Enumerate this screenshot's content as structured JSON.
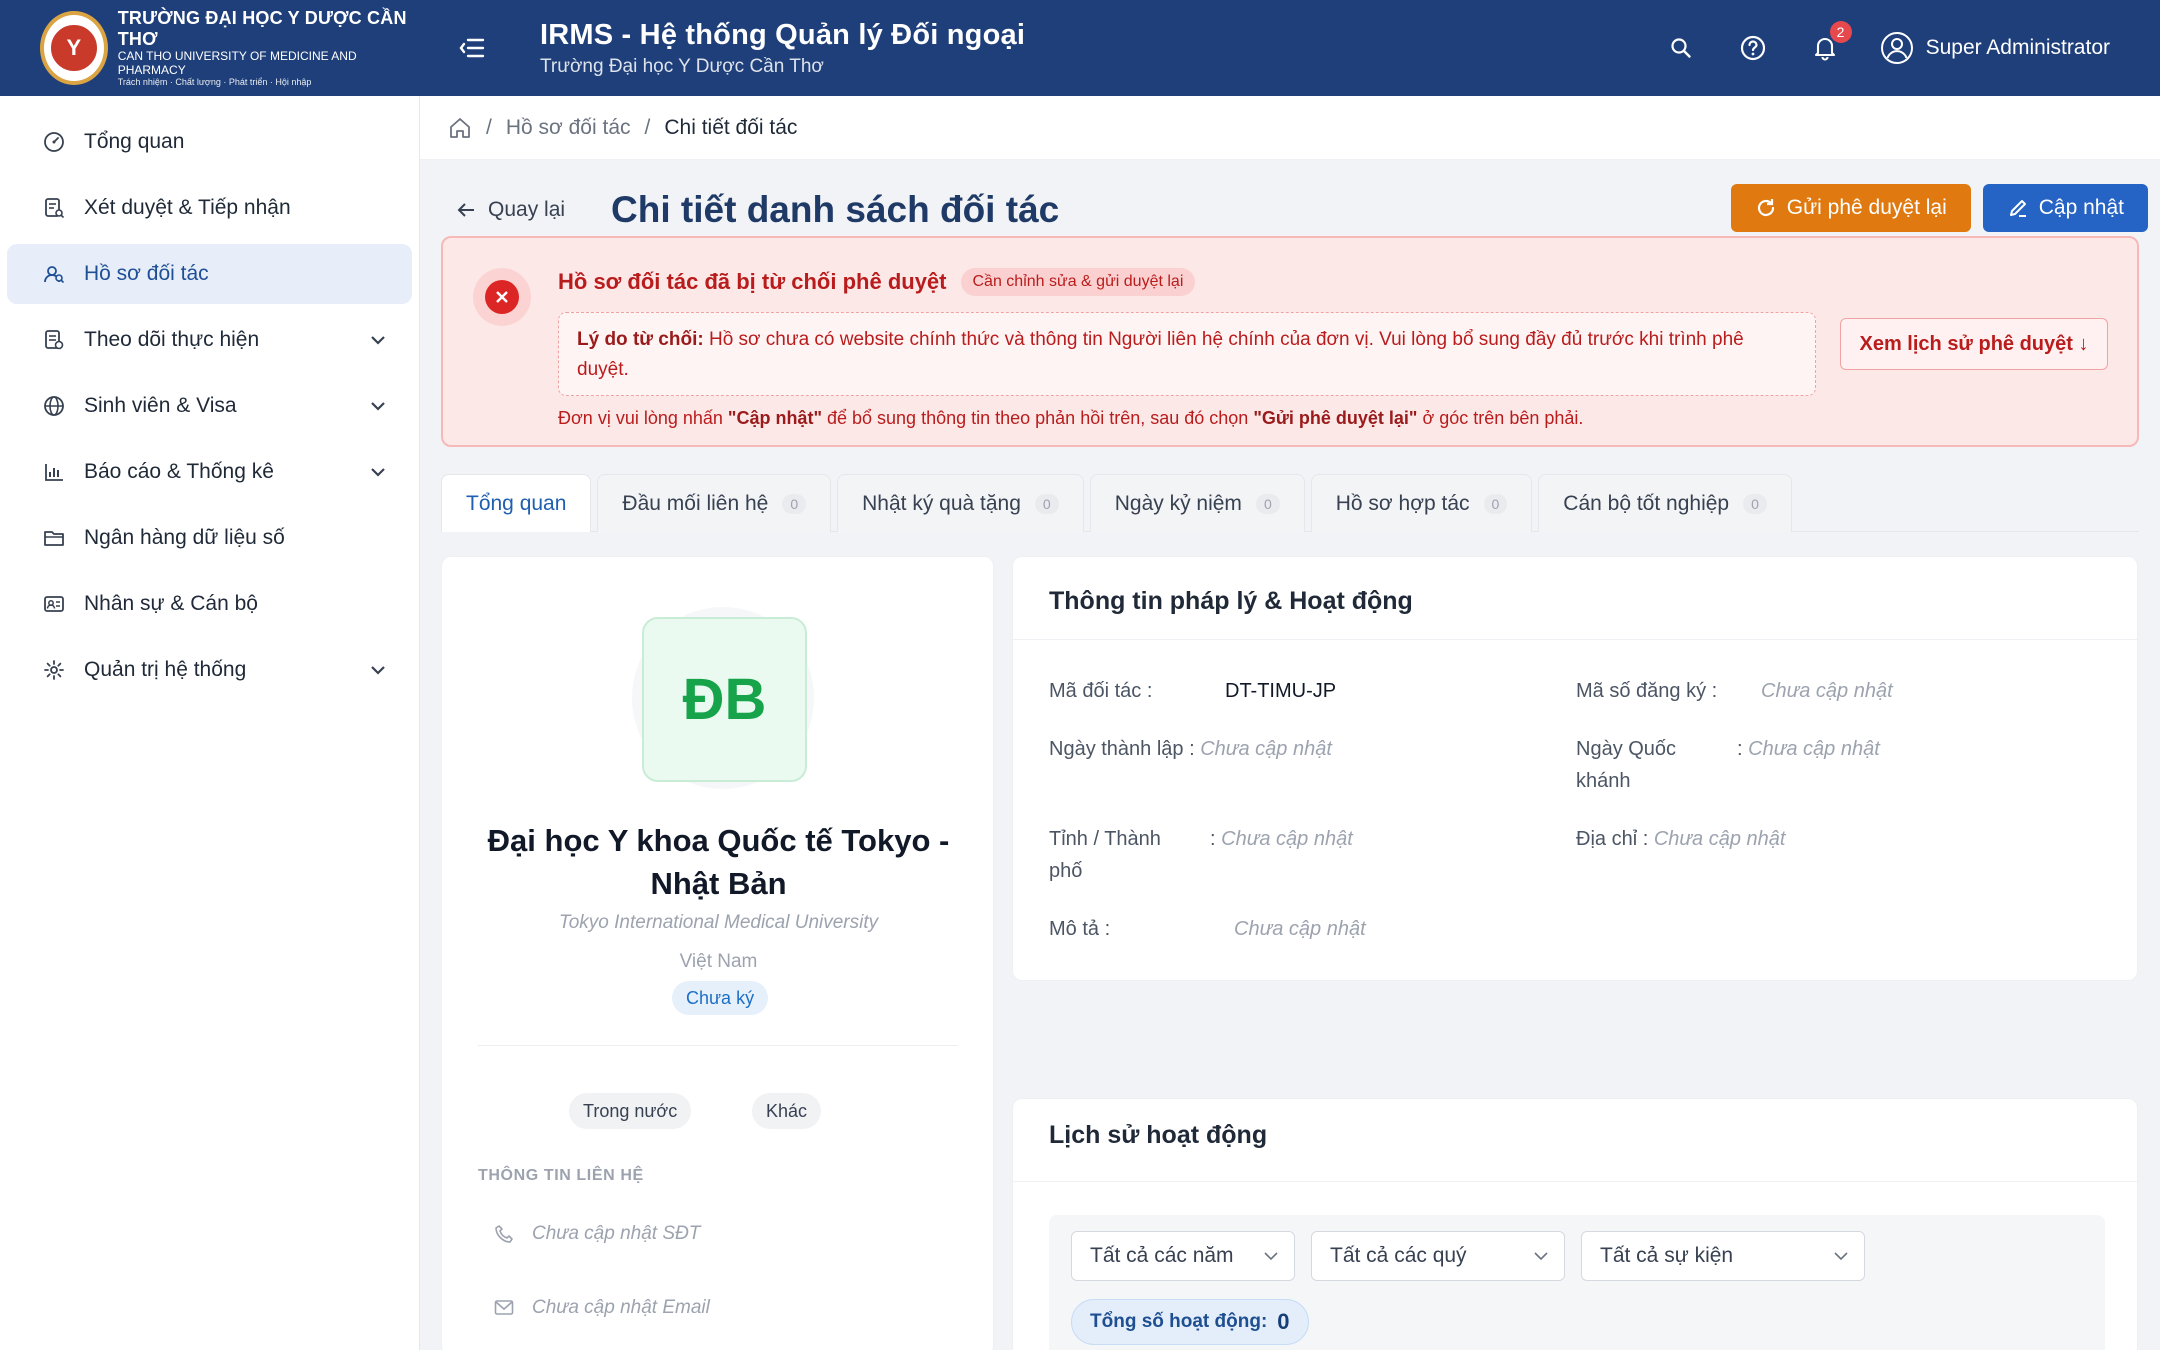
{
  "header": {
    "logo_initials": "Y",
    "logo_line1": "TRƯỜNG ĐẠI HỌC Y DƯỢC CẦN THƠ",
    "logo_line2": "CAN THO UNIVERSITY OF MEDICINE AND PHARMACY",
    "logo_line3": "Trách nhiệm · Chất lượng · Phát triển · Hội nhập",
    "app_title": "IRMS - Hệ thống Quản lý Đối ngoại",
    "app_subtitle": "Trường Đại học Y Dược Cần Thơ",
    "notification_count": "2",
    "user_name": "Super Administrator"
  },
  "sidebar": {
    "items": [
      {
        "label": "Tổng quan",
        "icon": "dashboard-icon"
      },
      {
        "label": "Xét duyệt & Tiếp nhận",
        "icon": "review-icon"
      },
      {
        "label": "Hồ sơ đối tác",
        "icon": "partners-icon",
        "active": true
      },
      {
        "label": "Theo dõi thực hiện",
        "icon": "tracking-icon",
        "expandable": true
      },
      {
        "label": "Sinh viên & Visa",
        "icon": "globe-icon",
        "expandable": true
      },
      {
        "label": "Báo cáo & Thống kê",
        "icon": "chart-icon",
        "expandable": true
      },
      {
        "label": "Ngân hàng dữ liệu số",
        "icon": "folder-icon"
      },
      {
        "label": "Nhân sự & Cán bộ",
        "icon": "id-card-icon"
      },
      {
        "label": "Quản trị hệ thống",
        "icon": "gear-icon",
        "expandable": true
      }
    ]
  },
  "breadcrumb": {
    "parent": "Hồ sơ đối tác",
    "current": "Chi tiết đối tác"
  },
  "page": {
    "back_label": "Quay lại",
    "title": "Chi tiết danh sách đối tác",
    "resubmit_label": "Gửi phê duyệt lại",
    "update_label": "Cập nhật"
  },
  "alert": {
    "title": "Hồ sơ đối tác đã bị từ chối phê duyệt",
    "tag": "Cần chỉnh sửa & gửi duyệt lại",
    "reason_label": "Lý do từ chối:",
    "reason_text": "Hồ sơ chưa có website chính thức và thông tin Người liên hệ chính của đơn vị. Vui lòng bổ sung đầy đủ trước khi trình phê duyệt.",
    "note_pre": "Đơn vị vui lòng nhấn ",
    "note_btn1": "\"Cập nhật\"",
    "note_mid": " để bổ sung thông tin theo phản hồi trên, sau đó chọn ",
    "note_btn2": "\"Gửi phê duyệt lại\"",
    "note_post": " ở góc trên bên phải.",
    "history_label": "Xem lịch sử phê duyệt ↓"
  },
  "tabs": [
    {
      "label": "Tổng quan",
      "active": true
    },
    {
      "label": "Đầu mối liên hệ",
      "count": "0"
    },
    {
      "label": "Nhật ký quà tặng",
      "count": "0"
    },
    {
      "label": "Ngày kỷ niệm",
      "count": "0"
    },
    {
      "label": "Hồ sơ hợp tác",
      "count": "0"
    },
    {
      "label": "Cán bộ tốt nghiệp",
      "count": "0"
    }
  ],
  "profile": {
    "initials": "ĐB",
    "name_line1": "Đại học Y khoa Quốc tế Tokyo -",
    "name_line2": "Nhật Bản",
    "name_en": "Tokyo International Medical University",
    "country": "Việt Nam",
    "sign_status": "Chưa ký",
    "chips": [
      "Trong nước",
      "Khác"
    ],
    "contact_section": "THÔNG TIN LIÊN HỆ",
    "phone": "Chưa cập nhật SĐT",
    "email": "Chưa cập nhật Email"
  },
  "legal": {
    "title": "Thông tin pháp lý & Hoạt động",
    "partner_code_label": "Mã đối tác",
    "partner_code": "DT-TIMU-JP",
    "reg_no_label": "Mã số đăng ký",
    "reg_no": "Chưa cập nhật",
    "founded_label": "Ngày thành lập",
    "founded": "Chưa cập nhật",
    "national_day_label_1": "Ngày Quốc",
    "national_day_label_2": "khánh",
    "national_day": "Chưa cập nhật",
    "province_label_1": "Tỉnh / Thành",
    "province_label_2": "phố",
    "province": "Chưa cập nhật",
    "address_label": "Địa chỉ",
    "address": "Chưa cập nhật",
    "desc_label": "Mô tả",
    "desc": "Chưa cập nhật"
  },
  "activity": {
    "title": "Lịch sử hoạt động",
    "filter_year": "Tất cả các năm",
    "filter_quarter": "Tất cả các quý",
    "filter_event": "Tất cả sự kiện",
    "total_label": "Tổng số hoạt động:",
    "total_value": "0"
  }
}
